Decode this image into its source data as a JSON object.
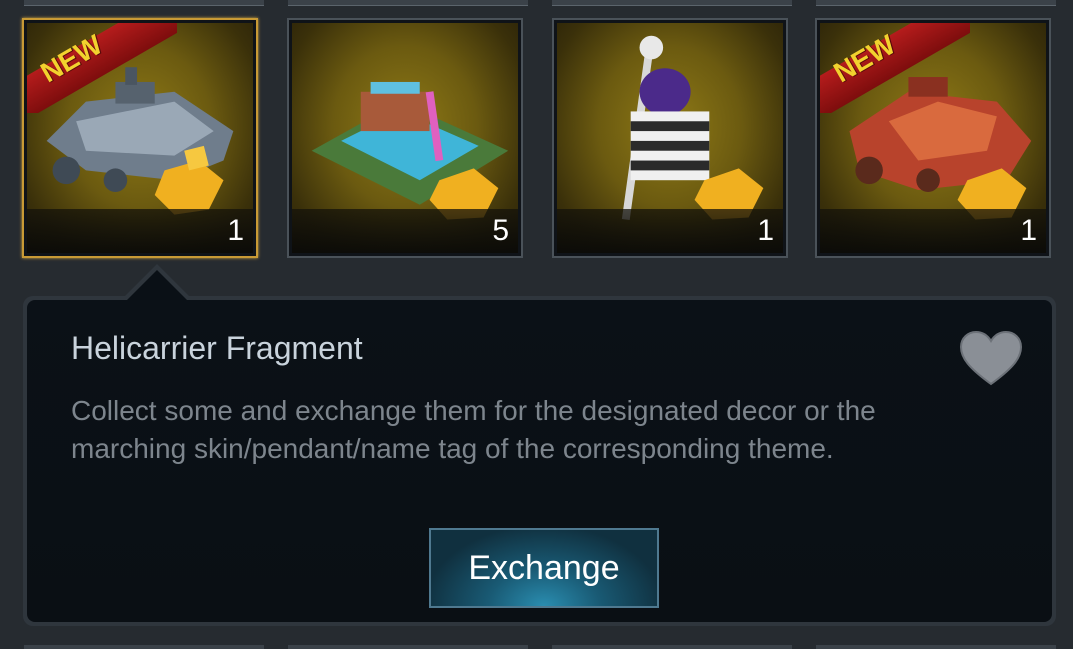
{
  "inventory": {
    "items": [
      {
        "name": "helicarrier",
        "count": "1",
        "new_label": "NEW",
        "is_new": true,
        "selected": true
      },
      {
        "name": "water-park",
        "count": "5",
        "is_new": false,
        "selected": false
      },
      {
        "name": "prisoner-reaper",
        "count": "1",
        "is_new": false,
        "selected": false
      },
      {
        "name": "red-gunship",
        "count": "1",
        "new_label": "NEW",
        "is_new": true,
        "selected": false
      }
    ]
  },
  "detail": {
    "title": "Helicarrier Fragment",
    "description": "Collect some and exchange them for the designated decor or the marching skin/pendant/name tag of the corresponding theme.",
    "favorite_icon": "heart-icon",
    "exchange_label": "Exchange"
  },
  "colors": {
    "selected_border": "#c89a35",
    "new_text": "#f2d22e",
    "new_ribbon": "#b51c1c",
    "button_glow": "#2a8db0"
  }
}
